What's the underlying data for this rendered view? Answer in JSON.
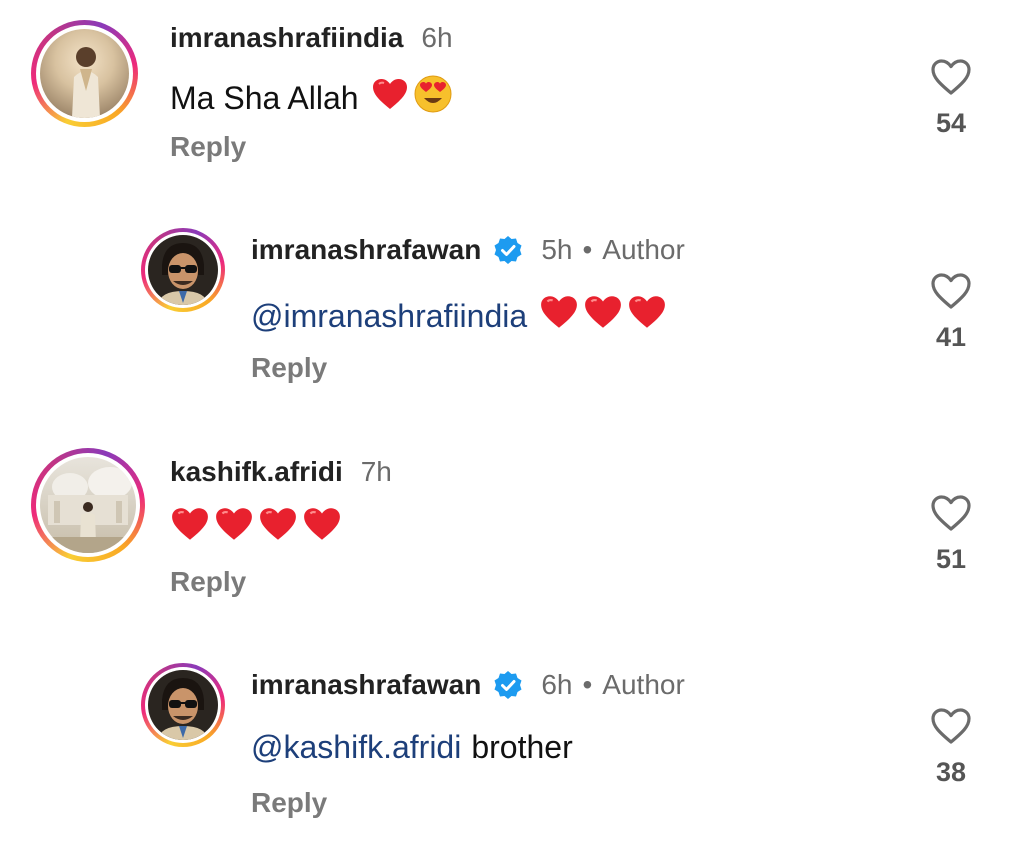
{
  "comments": [
    {
      "username": "imranashrafiindia",
      "time": "6h",
      "author_label": "",
      "mention": "",
      "text": "Ma Sha Allah",
      "emojis": [
        "red-heart",
        "heart-eyes"
      ],
      "reply_label": "Reply",
      "likes": "54"
    },
    {
      "username": "imranashrafawan",
      "time": "5h",
      "author_label": "Author",
      "verified": true,
      "mention": "@imranashrafiindia",
      "text": "",
      "emojis": [
        "red-heart",
        "red-heart",
        "red-heart"
      ],
      "reply_label": "Reply",
      "likes": "41"
    },
    {
      "username": "kashifk.afridi",
      "time": "7h",
      "author_label": "",
      "mention": "",
      "text": "",
      "emojis": [
        "red-heart",
        "red-heart",
        "red-heart",
        "red-heart"
      ],
      "reply_label": "Reply",
      "likes": "51"
    },
    {
      "username": "imranashrafawan",
      "time": "6h",
      "author_label": "Author",
      "verified": true,
      "mention": "@kashifk.afridi",
      "text": "brother",
      "emojis": [],
      "reply_label": "Reply",
      "likes": "38"
    }
  ],
  "colors": {
    "mention": "#1d3f7a",
    "verified_badge": "#1d9bf0",
    "heart_emoji": "#e8212e",
    "muted_text": "#6b6b6b"
  },
  "icons": {
    "like": "heart-outline-icon",
    "verified": "verified-badge-icon"
  }
}
